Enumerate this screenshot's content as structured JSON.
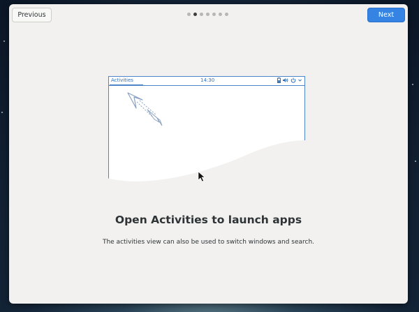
{
  "header": {
    "previous_label": "Previous",
    "next_label": "Next",
    "page_count": 7,
    "active_page": 2
  },
  "illustration": {
    "panel_label": "Activities",
    "clock": "14:30",
    "tray_icons": [
      "battery-icon",
      "volume-icon",
      "power-icon",
      "chevron-down-icon"
    ]
  },
  "content": {
    "title": "Open Activities to launch apps",
    "description": "The activities view can also be used to switch windows and search."
  },
  "colors": {
    "accent": "#3584e4",
    "illustration_line": "#4a86c8",
    "window_bg": "#f2f1ef"
  }
}
